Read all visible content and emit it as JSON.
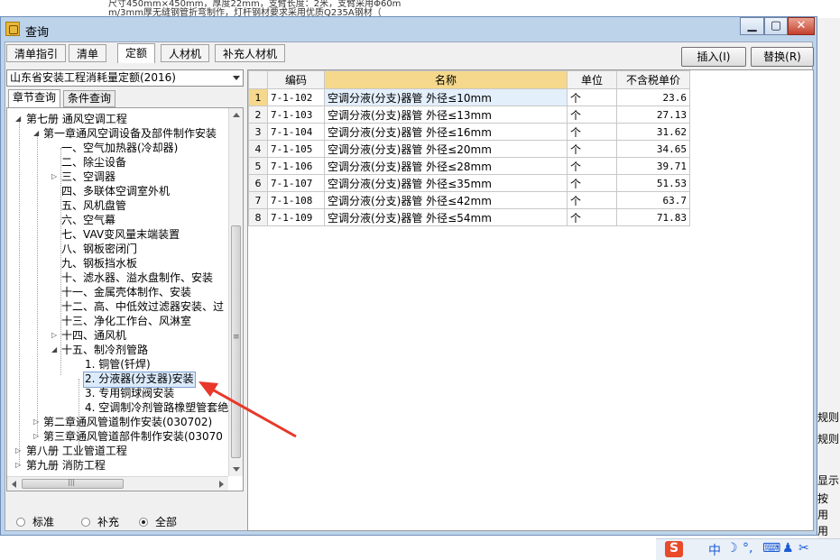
{
  "background": {
    "top_lines": [
      "尺寸450mm×450mm，厚度22mm，支臂长度：2米，支臂采用Φ60m",
      "m/3mm厚无缝钢管折弯制作，灯杆钢材要求采用优质Q235A钢材（"
    ],
    "right_labels": [
      "规则",
      "规则",
      "显示",
      "按",
      "用",
      "用"
    ]
  },
  "window": {
    "title": "查询",
    "minimize": "▁",
    "maximize": "▢",
    "close": "✕"
  },
  "tabs": [
    {
      "label": "清单指引",
      "active": false
    },
    {
      "label": "清单",
      "active": false
    },
    {
      "label": "定额",
      "active": true
    },
    {
      "label": "人材机",
      "active": false
    },
    {
      "label": "补充人材机",
      "active": false
    }
  ],
  "buttons": {
    "insert": "插入(I)",
    "replace": "替换(R)"
  },
  "quota_combo": {
    "value": "山东省安装工程消耗量定额(2016)"
  },
  "subtabs": [
    {
      "label": "章节查询",
      "active": true
    },
    {
      "label": "条件查询",
      "active": false
    }
  ],
  "tree": [
    {
      "label": "第七册 通风空调工程",
      "expander": "◢"
    },
    {
      "label": "第一章通风空调设备及部件制作安装",
      "expander": "◢"
    },
    {
      "label": "一、空气加热器(冷却器)",
      "expander": ""
    },
    {
      "label": "二、除尘设备",
      "expander": ""
    },
    {
      "label": "三、空调器",
      "expander": "▷"
    },
    {
      "label": "四、多联体空调室外机",
      "expander": ""
    },
    {
      "label": "五、风机盘管",
      "expander": ""
    },
    {
      "label": "六、空气幕",
      "expander": ""
    },
    {
      "label": "七、VAV变风量末端装置",
      "expander": ""
    },
    {
      "label": "八、钢板密闭门",
      "expander": ""
    },
    {
      "label": "九、钢板挡水板",
      "expander": ""
    },
    {
      "label": "十、滤水器、溢水盘制作、安装",
      "expander": ""
    },
    {
      "label": "十一、金属壳体制作、安装",
      "expander": ""
    },
    {
      "label": "十二、高、中低效过滤器安装、过",
      "expander": ""
    },
    {
      "label": "十三、净化工作台、风淋室",
      "expander": ""
    },
    {
      "label": "十四、通风机",
      "expander": "▷"
    },
    {
      "label": "十五、制冷剂管路",
      "expander": "◢"
    },
    {
      "label": "1. 铜管(钎焊)",
      "expander": ""
    },
    {
      "label": "2. 分液器(分支器)安装",
      "expander": ""
    },
    {
      "label": "3. 专用铜球阀安装",
      "expander": ""
    },
    {
      "label": "4. 空调制冷剂管路橡塑管套绝",
      "expander": ""
    },
    {
      "label": "第二章通风管道制作安装(030702)",
      "expander": "▷"
    },
    {
      "label": "第三章通风管道部件制作安装(03070",
      "expander": "▷"
    },
    {
      "label": "第八册 工业管道工程",
      "expander": "▷"
    },
    {
      "label": "第九册 消防工程",
      "expander": "▷"
    }
  ],
  "scroll_marker": "≡",
  "hscroll_marker": "|||",
  "radios": [
    {
      "label": "标准",
      "checked": false
    },
    {
      "label": "补充",
      "checked": false
    },
    {
      "label": "全部",
      "checked": true
    }
  ],
  "grid": {
    "headers": [
      "",
      "编码",
      "名称",
      "单位",
      "不含税单价"
    ],
    "rows": [
      [
        "1",
        "7-1-102",
        "空调分液(分支)器管 外径≤10mm",
        "个",
        "23.6"
      ],
      [
        "2",
        "7-1-103",
        "空调分液(分支)器管 外径≤13mm",
        "个",
        "27.13"
      ],
      [
        "3",
        "7-1-104",
        "空调分液(分支)器管 外径≤16mm",
        "个",
        "31.62"
      ],
      [
        "4",
        "7-1-105",
        "空调分液(分支)器管 外径≤20mm",
        "个",
        "34.65"
      ],
      [
        "5",
        "7-1-106",
        "空调分液(分支)器管 外径≤28mm",
        "个",
        "39.71"
      ],
      [
        "6",
        "7-1-107",
        "空调分液(分支)器管 外径≤35mm",
        "个",
        "51.53"
      ],
      [
        "7",
        "7-1-108",
        "空调分液(分支)器管 外径≤42mm",
        "个",
        "63.7"
      ],
      [
        "8",
        "7-1-109",
        "空调分液(分支)器管 外径≤54mm",
        "个",
        "71.83"
      ]
    ]
  },
  "taskbar": {
    "ime_logo": "S",
    "ime_mode": "中",
    "moon": "☽",
    "punct": "°,",
    "keyboard": "⌨",
    "user": "♟",
    "tools": "✂"
  },
  "colors": {
    "accent_header": "#f5d88c",
    "selection": "#dcebfc",
    "annotation_arrow": "#e8382a"
  }
}
